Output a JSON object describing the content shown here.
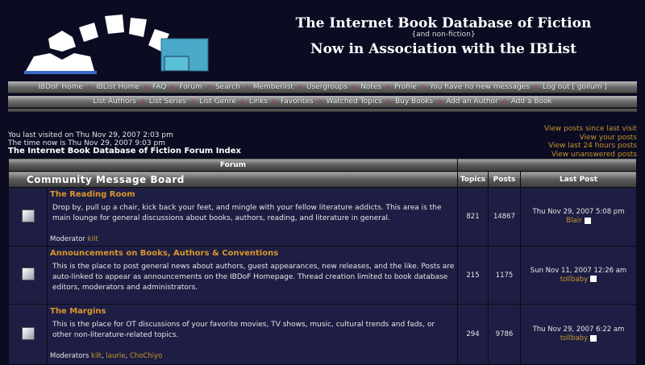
{
  "header": {
    "title": "The Internet Book Database of Fiction",
    "subtitle": "{and non-fiction}",
    "tagline": "Now in Association with the IBList"
  },
  "nav1": [
    "IBDoF Home",
    "IBList Home",
    "FAQ",
    "Forum",
    "Search",
    "Memberlist",
    "Usergroups",
    "Notes",
    "Profile",
    "You have no new messages",
    "Log out [ gollum ]"
  ],
  "nav2": [
    "List Authors",
    "List Series",
    "List Genre",
    "Links",
    "Favorites",
    "Watched Topics",
    "Buy Books",
    "Add an Author",
    "Add a Book"
  ],
  "info": {
    "last_visit": "You last visited on Thu Nov 29, 2007 2:03 pm",
    "time_now": "The time now is Thu Nov 29, 2007 9:03 pm",
    "index_link": "The Internet Book Database of Fiction Forum Index"
  },
  "quick_links": [
    "View posts since last visit",
    "View your posts",
    "View last 24 hours posts",
    "View unanswered posts"
  ],
  "table": {
    "forum_header": "Forum",
    "category": "Community Message Board",
    "col_topics": "Topics",
    "col_posts": "Posts",
    "col_last": "Last Post",
    "forums": [
      {
        "name": "The Reading Room",
        "desc": "Drop by, pull up a chair, kick back your feet, and mingle with your fellow literature addicts. This area is the main lounge for general discussions about books, authors, reading, and literature in general.",
        "mod_label": "Moderator",
        "mods": [
          "kilt"
        ],
        "topics": "821",
        "posts": "14867",
        "last_date": "Thu Nov 29, 2007 5:08 pm",
        "last_user": "Blair"
      },
      {
        "name": "Announcements on Books, Authors & Conventions",
        "desc": "This is the place to post general news about authors, guest appearances, new releases, and the like. Posts are auto-linked to appear as announcements on the IBDoF Homepage. Thread creation limited to book database editors, moderators and administrators.",
        "mod_label": "",
        "mods": [],
        "topics": "215",
        "posts": "1175",
        "last_date": "Sun Nov 11, 2007 12:26 am",
        "last_user": "tollbaby"
      },
      {
        "name": "The Margins",
        "desc": "This is the place for OT discussions of your favorite movies, TV shows, music, cultural trends and fads, or other non-literature-related topics.",
        "mod_label": "Moderators",
        "mods": [
          "kilt",
          "laurie",
          "ChoChiyo"
        ],
        "topics": "294",
        "posts": "9786",
        "last_date": "Thu Nov 29, 2007 6:22 am",
        "last_user": "tollbaby"
      }
    ]
  }
}
